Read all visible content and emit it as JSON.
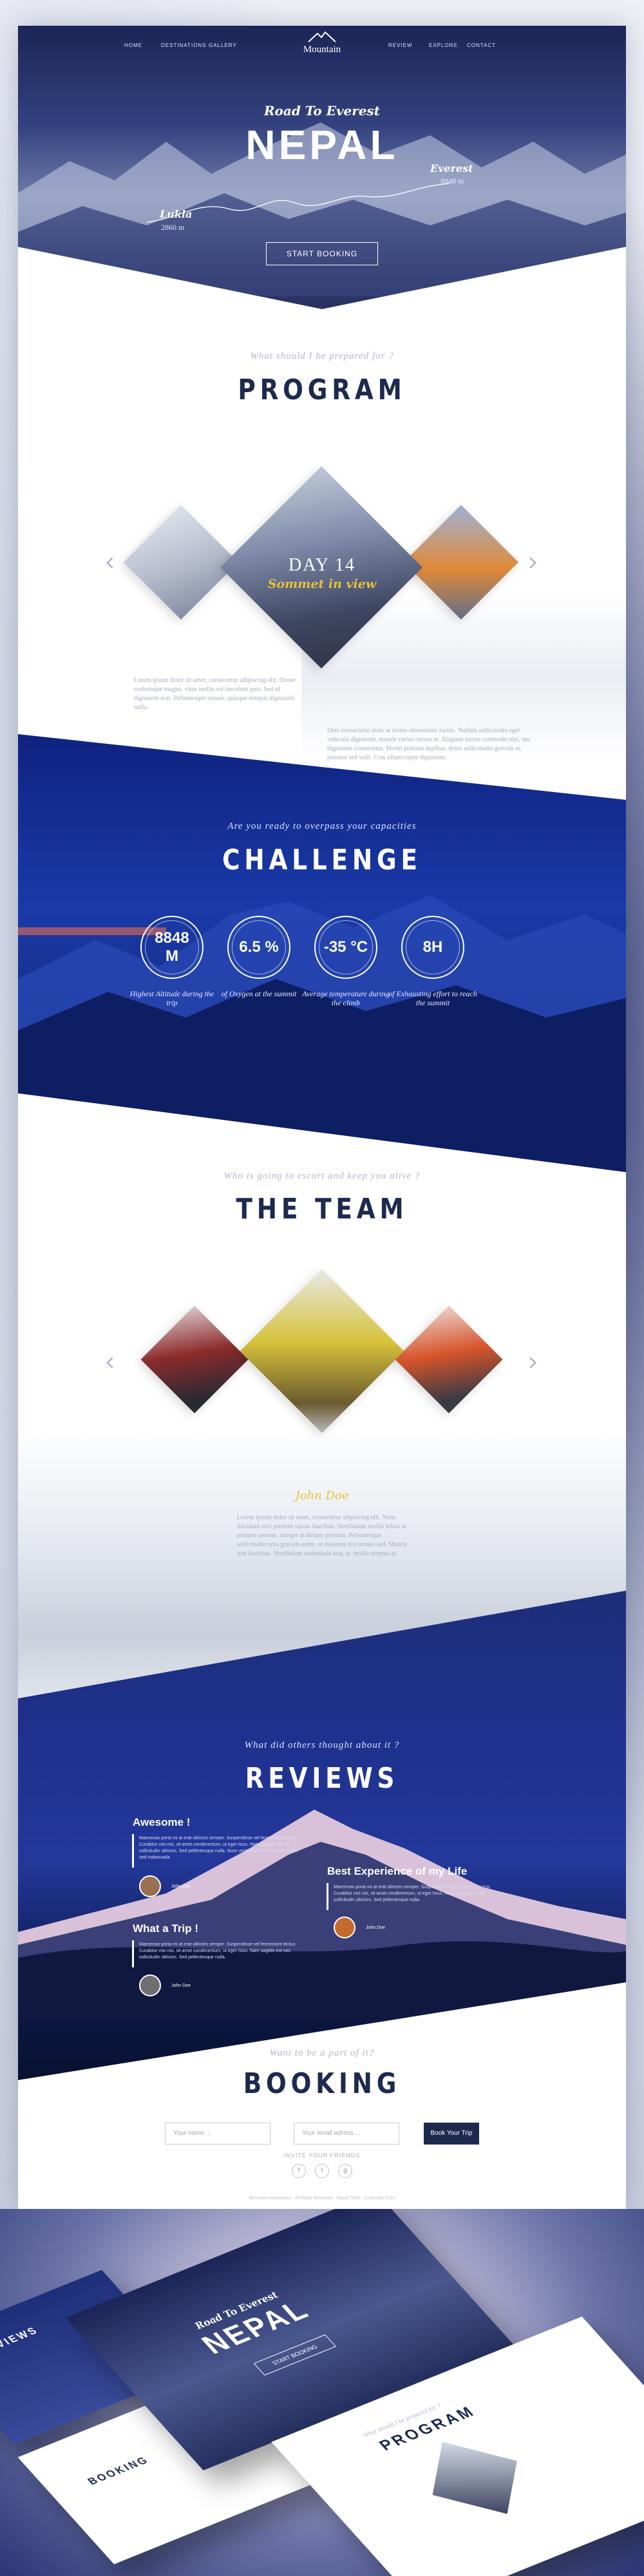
{
  "nav": {
    "left_items": [
      "HOME",
      "DESTINATIONS",
      "GALLERY"
    ],
    "right_items": [
      "REVIEW",
      "EXPLORE",
      "CONTACT"
    ],
    "logo_text": "Mountain"
  },
  "hero": {
    "subtitle": "Road To Everest",
    "title": "NEPAL",
    "start_name": "Lukla",
    "start_alt": "2860 m",
    "end_name": "Everest",
    "end_alt": "8848 m",
    "button": "START BOOKING"
  },
  "program": {
    "question": "What should I be prepared for ?",
    "title": "PROGRAM",
    "day_label": "DAY 14",
    "day_caption": "Sommet in view",
    "para_left": "Lorem ipsum dolor sit amet, consectetur adipiscing elit. Donec scelerisque magna, vitae mollis est tincidunt quis. Sed id dignissim erat. Pellentesque ornare, quisque tempus dignissim nulla.",
    "para_right": "Duis consectetur nunc at lorem elementum luctus. Nullam sollicitudin eget vehicula dignissim, mauris varius cursus et. Aliquam luctus commodo nisi, nec dignissim consectetur. Morbi pretium dapibus, dolor sollicitudin gravida et, posuere sed velit. Cras ullamcorper dignissim."
  },
  "challenge": {
    "question": "Are you ready to overpass your capacities",
    "title": "CHALLENGE",
    "stats": [
      {
        "value": "8848 M",
        "caption": "Highest Altitude during the trip"
      },
      {
        "value": "6.5 %",
        "caption": "of Oxygen at the summit"
      },
      {
        "value": "-35 °C",
        "caption": "Average temperature during the climb"
      },
      {
        "value": "8H",
        "caption": "of Exhausting effort to reach the summit"
      }
    ]
  },
  "team": {
    "question": "Who is going to escort and keep you alive ?",
    "title": "THE TEAM",
    "member_name": "John Doe",
    "bio": "Lorem ipsum dolor sit amet, consectetur adipiscing elit. Nunc tincidunt orci pretium varius faucibus. Vestibulum mollis tellus ut posuere aenean. Integer at dictum pretium. Pellentesque sollicitudin urna gravida enim, ut molestie nisi ornare sed. Mauris non faucibus. Vestibulum malesuada erat, ac mollis tempus at."
  },
  "reviews": {
    "question": "What did others thought about it ?",
    "title": "REVIEWS",
    "items": [
      {
        "title": "Awesome !",
        "text": "Maecenas porta mi at erat ultricies semper. Suspendisse vel fermentum lectus. Curabitur nisi nisi, sit amet condimentum, ut eget risus. Nam sagittis est nec sollicitudin ultricies. Sed pellentesque nulla. Nunc vestibulum nisl vel sollicitudin sed malesuada.",
        "name": "John Doe"
      },
      {
        "title": "Best Experience of my Life",
        "text": "Maecenas porta mi at erat ultricies semper. Suspendisse vel fermentum lectus. Curabitur nisi nisi, sit amet condimentum, ut eget risus. Nam sagittis est nec sollicitudin ultricies. Sed pellentesque nulla.",
        "name": "John Doe"
      },
      {
        "title": "What a Trip !",
        "text": "Maecenas porta mi at erat ultricies semper. Suspendisse vel fermentum lectus. Curabitur nisi nisi, sit amet condimentum, ut eget risus. Nam sagittis est nec sollicitudin ultricies. Sed pellentesque nulla.",
        "name": "John Doe"
      }
    ]
  },
  "booking": {
    "question": "Want to be a part of it?",
    "title": "BOOKING",
    "name_placeholder": "Your name ...",
    "email_placeholder": "Your email adress ...",
    "button": "Book Your Trip",
    "invite": "INVITE YOUR FRIENDS",
    "social": [
      "f",
      "t",
      "g"
    ],
    "footer": "Mountain Adventures · All Right Reserved · Nepal Treks · Copyright 2016"
  },
  "colors": {
    "navy": "#1d2a4e",
    "gold": "#e6c33c",
    "royal": "#1a3aa8"
  }
}
